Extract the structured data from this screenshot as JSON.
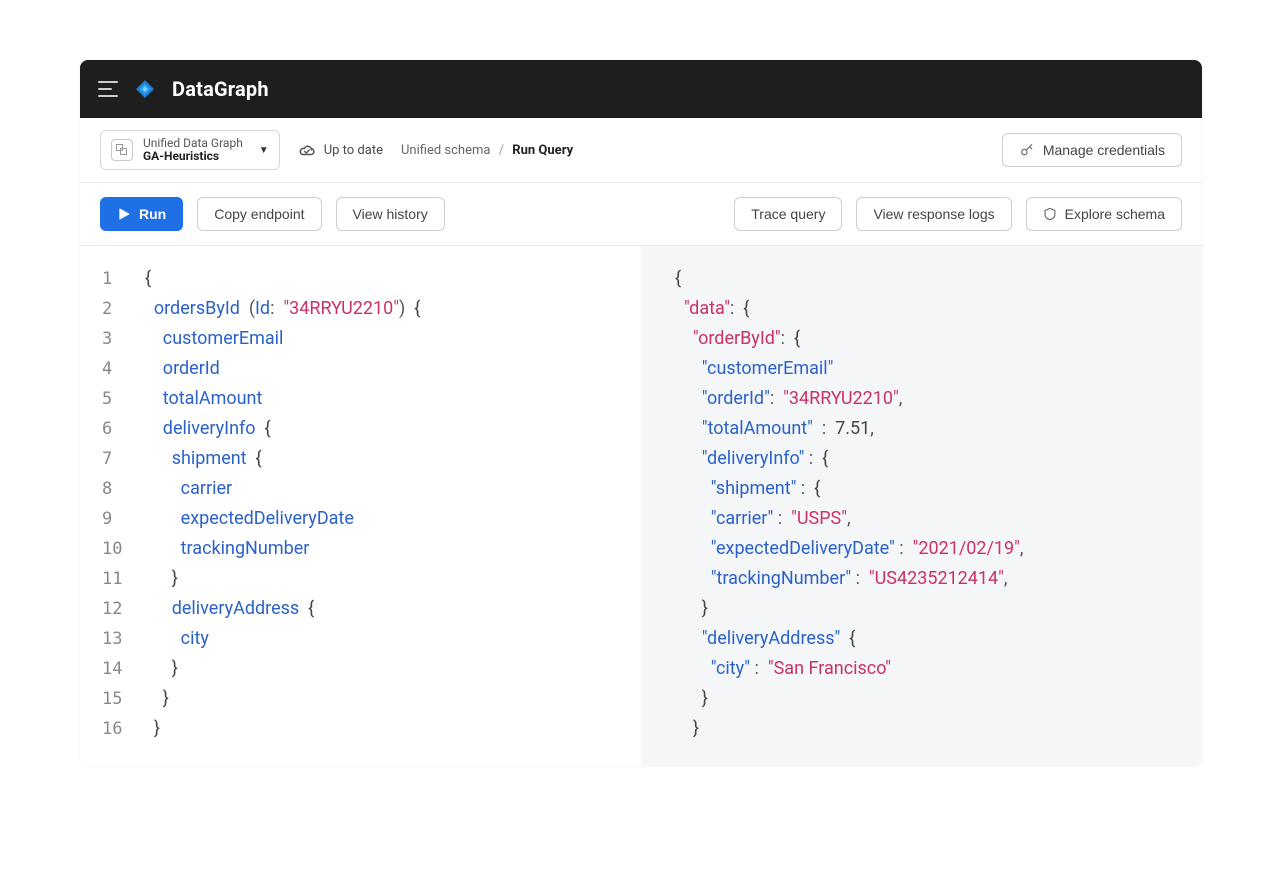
{
  "brand": "DataGraph",
  "graphSelector": {
    "line1": "Unified Data Graph",
    "line2": "GA-Heuristics"
  },
  "status": {
    "label": "Up to date"
  },
  "breadcrumb": {
    "parent": "Unified schema",
    "current": "Run Query"
  },
  "buttons": {
    "manageCredentials": "Manage credentials",
    "run": "Run",
    "copyEndpoint": "Copy endpoint",
    "viewHistory": "View history",
    "traceQuery": "Trace query",
    "viewResponseLogs": "View response logs",
    "exploreSchema": "Explore schema"
  },
  "query": {
    "lineNumbers": [
      "1",
      "2",
      "3",
      "4",
      "5",
      "6",
      "7",
      "8",
      "9",
      "10",
      "11",
      "12",
      "13",
      "14",
      "15",
      "16"
    ],
    "root": "ordersById",
    "argName": "Id",
    "argValue": "\"34RRYU2210\"",
    "fields": {
      "customerEmail": "customerEmail",
      "orderId": "orderId",
      "totalAmount": "totalAmount",
      "deliveryInfo": "deliveryInfo",
      "shipment": "shipment",
      "carrier": "carrier",
      "expectedDeliveryDate": "expectedDeliveryDate",
      "trackingNumber": "trackingNumber",
      "deliveryAddress": "deliveryAddress",
      "city": "city"
    }
  },
  "response": {
    "keys": {
      "data": "\"data\"",
      "orderById": "\"orderById\"",
      "customerEmail": "\"customerEmail\"",
      "orderId": "\"orderId\"",
      "totalAmount": "\"totalAmount\"",
      "deliveryInfo": "\"deliveryInfo\"",
      "shipment": "\"shipment\"",
      "carrier": "\"carrier\"",
      "expectedDeliveryDate": "\"expectedDeliveryDate\"",
      "trackingNumber": "\"trackingNumber\"",
      "deliveryAddress": "\"deliveryAddress\"",
      "city": "\"city\""
    },
    "values": {
      "orderId": "\"34RRYU2210\"",
      "totalAmount": "7.51",
      "carrier": "\"USPS\"",
      "expectedDeliveryDate": "\"2021/02/19\"",
      "trackingNumber": "\"US4235212414\"",
      "city": "\"San Francisco\""
    }
  }
}
